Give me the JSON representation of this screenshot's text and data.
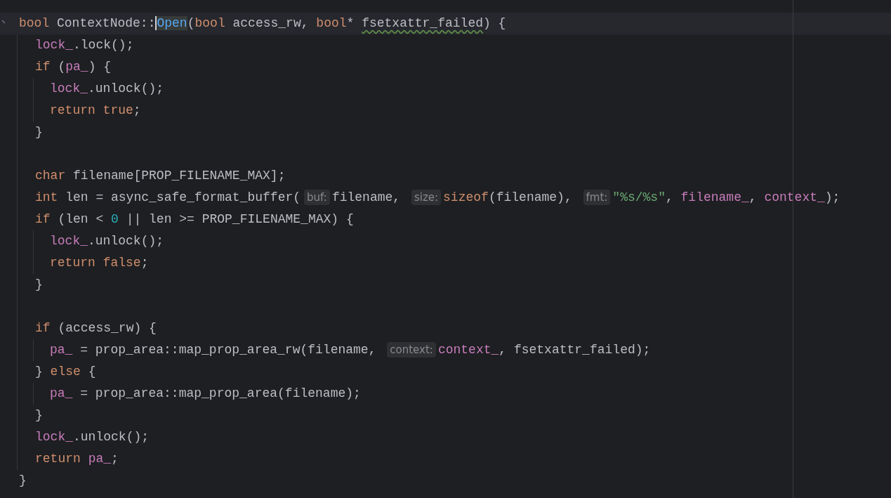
{
  "editor": {
    "lines": [
      {
        "kind": "code",
        "current": true,
        "tokens": [
          {
            "kind": "keyword",
            "text": "bool"
          },
          {
            "kind": "plain",
            "text": " ContextNode::"
          },
          {
            "kind": "function",
            "text": "Open",
            "caret": true
          },
          {
            "kind": "plain",
            "text": "("
          },
          {
            "kind": "keyword",
            "text": "bool"
          },
          {
            "kind": "plain",
            "text": " access_rw, "
          },
          {
            "kind": "keyword",
            "text": "bool"
          },
          {
            "kind": "plain",
            "text": "* "
          },
          {
            "kind": "warning",
            "text": "fsetxattr_failed"
          },
          {
            "kind": "plain",
            "text": ") {"
          }
        ],
        "children": [
          {
            "kind": "code",
            "tokens": [
              {
                "kind": "member",
                "text": "lock_"
              },
              {
                "kind": "plain",
                "text": ".lock();"
              }
            ]
          },
          {
            "kind": "code",
            "tokens": [
              {
                "kind": "keyword",
                "text": "if"
              },
              {
                "kind": "plain",
                "text": " ("
              },
              {
                "kind": "member",
                "text": "pa_"
              },
              {
                "kind": "plain",
                "text": ") {"
              }
            ],
            "children": [
              {
                "kind": "code",
                "tokens": [
                  {
                    "kind": "member",
                    "text": "lock_"
                  },
                  {
                    "kind": "plain",
                    "text": ".unlock();"
                  }
                ]
              },
              {
                "kind": "code",
                "tokens": [
                  {
                    "kind": "keyword",
                    "text": "return true"
                  },
                  {
                    "kind": "plain",
                    "text": ";"
                  }
                ]
              }
            ]
          },
          {
            "kind": "code",
            "tokens": [
              {
                "kind": "plain",
                "text": "}"
              }
            ]
          },
          {
            "kind": "blank"
          },
          {
            "kind": "code",
            "tokens": [
              {
                "kind": "keyword",
                "text": "char"
              },
              {
                "kind": "plain",
                "text": " filename[PROP_FILENAME_MAX];"
              }
            ]
          },
          {
            "kind": "code",
            "tokens": [
              {
                "kind": "keyword",
                "text": "int"
              },
              {
                "kind": "plain",
                "text": " len = async_safe_format_buffer("
              },
              {
                "kind": "hint",
                "text": "buf:"
              },
              {
                "kind": "plain",
                "text": "filename, "
              },
              {
                "kind": "hint",
                "text": "size:"
              },
              {
                "kind": "keyword",
                "text": "sizeof"
              },
              {
                "kind": "plain",
                "text": "(filename), "
              },
              {
                "kind": "hint",
                "text": "fmt:"
              },
              {
                "kind": "string",
                "text": "\"%s/%s\""
              },
              {
                "kind": "plain",
                "text": ", "
              },
              {
                "kind": "member",
                "text": "filename_"
              },
              {
                "kind": "plain",
                "text": ", "
              },
              {
                "kind": "member",
                "text": "context_"
              },
              {
                "kind": "plain",
                "text": ");"
              }
            ]
          },
          {
            "kind": "code",
            "tokens": [
              {
                "kind": "keyword",
                "text": "if"
              },
              {
                "kind": "plain",
                "text": " (len < "
              },
              {
                "kind": "number",
                "text": "0"
              },
              {
                "kind": "plain",
                "text": " || len >= PROP_FILENAME_MAX) {"
              }
            ],
            "children": [
              {
                "kind": "code",
                "tokens": [
                  {
                    "kind": "member",
                    "text": "lock_"
                  },
                  {
                    "kind": "plain",
                    "text": ".unlock();"
                  }
                ]
              },
              {
                "kind": "code",
                "tokens": [
                  {
                    "kind": "keyword",
                    "text": "return false"
                  },
                  {
                    "kind": "plain",
                    "text": ";"
                  }
                ]
              }
            ]
          },
          {
            "kind": "code",
            "tokens": [
              {
                "kind": "plain",
                "text": "}"
              }
            ]
          },
          {
            "kind": "blank"
          },
          {
            "kind": "code",
            "tokens": [
              {
                "kind": "keyword",
                "text": "if"
              },
              {
                "kind": "plain",
                "text": " (access_rw) {"
              }
            ],
            "children": [
              {
                "kind": "code",
                "tokens": [
                  {
                    "kind": "member",
                    "text": "pa_"
                  },
                  {
                    "kind": "plain",
                    "text": " = prop_area::map_prop_area_rw(filename, "
                  },
                  {
                    "kind": "hint",
                    "text": "context:"
                  },
                  {
                    "kind": "member",
                    "text": "context_"
                  },
                  {
                    "kind": "plain",
                    "text": ", fsetxattr_failed);"
                  }
                ]
              }
            ]
          },
          {
            "kind": "code",
            "tokens": [
              {
                "kind": "plain",
                "text": "} "
              },
              {
                "kind": "keyword",
                "text": "else"
              },
              {
                "kind": "plain",
                "text": " {"
              }
            ],
            "children": [
              {
                "kind": "code",
                "tokens": [
                  {
                    "kind": "member",
                    "text": "pa_"
                  },
                  {
                    "kind": "plain",
                    "text": " = prop_area::map_prop_area(filename);"
                  }
                ]
              }
            ]
          },
          {
            "kind": "code",
            "tokens": [
              {
                "kind": "plain",
                "text": "}"
              }
            ]
          },
          {
            "kind": "code",
            "tokens": [
              {
                "kind": "member",
                "text": "lock_"
              },
              {
                "kind": "plain",
                "text": ".unlock();"
              }
            ]
          },
          {
            "kind": "code",
            "tokens": [
              {
                "kind": "keyword",
                "text": "return "
              },
              {
                "kind": "member",
                "text": "pa_"
              },
              {
                "kind": "plain",
                "text": ";"
              }
            ]
          }
        ]
      },
      {
        "kind": "code",
        "tokens": [
          {
            "kind": "plain",
            "text": "}"
          }
        ]
      }
    ]
  }
}
